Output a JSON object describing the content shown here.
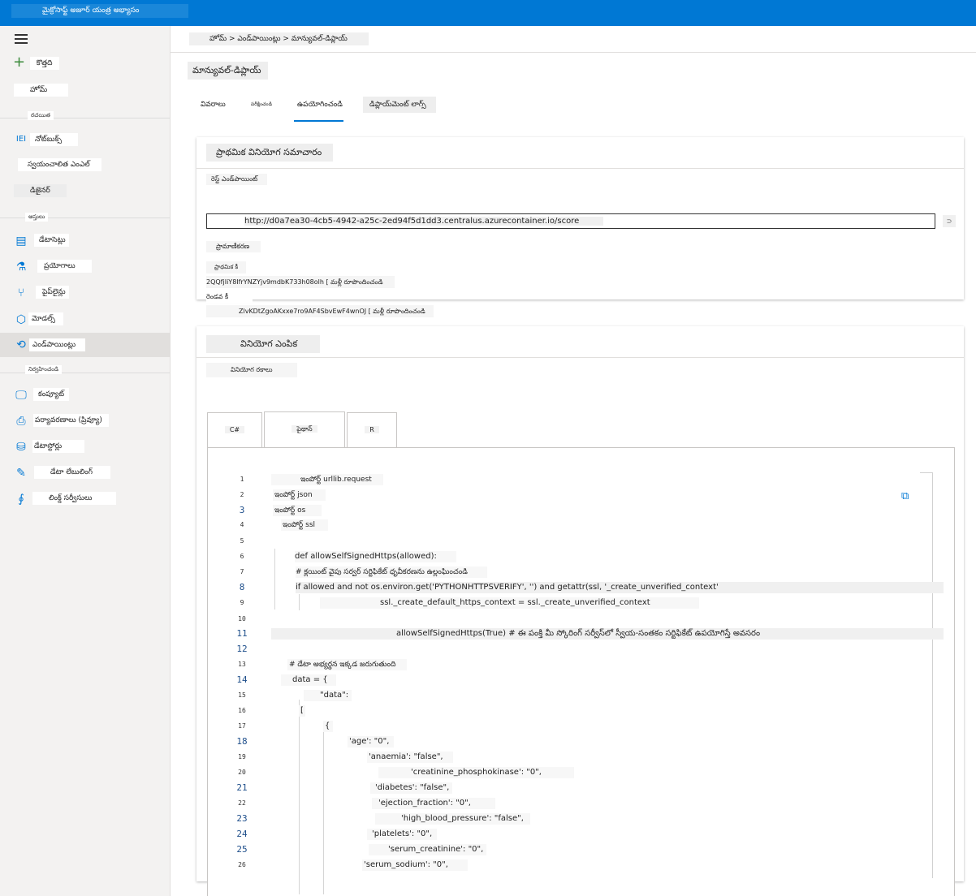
{
  "app": {
    "title": "మైక్రోసాఫ్ట్ అజూర్ యంత్ర అభ్యాసం"
  },
  "sidebar": {
    "new_label": "కొత్తది",
    "home_label": "హోమ్",
    "section_author": "రచయిత",
    "items_author": [
      {
        "label": "నోట్‌బుక్స్",
        "icon": "notebook-icon"
      },
      {
        "label": "స్వయంచాలిత ఎంఎల్",
        "icon": "automl-icon"
      },
      {
        "label": "డిజైనర్",
        "icon": "designer-icon"
      }
    ],
    "section_assets": "ఆస్తులు",
    "items_assets": [
      {
        "label": "డేటాసెట్లు",
        "icon": "dataset-icon"
      },
      {
        "label": "ప్రయోగాలు",
        "icon": "flask-icon"
      },
      {
        "label": "పైప్‌లైన్లు",
        "icon": "pipeline-icon"
      },
      {
        "label": "మోడల్స్",
        "icon": "cube-icon"
      },
      {
        "label": "ఎండ్‌పాయింట్లు",
        "icon": "endpoint-icon"
      }
    ],
    "section_manage": "నిర్వహించండి",
    "items_manage": [
      {
        "label": "కంప్యూట్",
        "icon": "monitor-icon"
      },
      {
        "label": "పర్యావరణాలు (ప్రివ్యూ)",
        "icon": "environment-icon"
      },
      {
        "label": "డేటాస్టోర్లు",
        "icon": "database-icon"
      },
      {
        "label": "డేటా లేబులింగ్",
        "icon": "edit-icon"
      },
      {
        "label": "లింక్డ్ సర్వీసులు",
        "icon": "link-icon"
      }
    ]
  },
  "breadcrumb": "హోమ్ > ఎండ్‌పాయింట్లు > మాన్యువల్-డిప్లాయ్",
  "page_title": "మాన్యువల్-డిప్లాయ్",
  "tabs": [
    "వివరాలు",
    "పరీక్షించండి",
    "ఉపయోగించండి",
    "డిప్లాయ్‌మెంట్ లాగ్స్"
  ],
  "basic_info": {
    "header": "ప్రాథమిక వినియోగ సమాచారం",
    "rest_label": "రెస్ట్ ఎండ్‌పాయింట్",
    "rest_url": "http://d0a7ea30-4cb5-4942-a25c-2ed94f5d1dd3.centralus.azurecontainer.io/score",
    "auth_label": "ప్రామాణీకరణ",
    "primary_label": "ప్రాథమిక కీ",
    "primary_key": "2QQfjIiY8IfrYNZYjv9mdbK733h08olh [ మళ్లీ రూపొందించండి",
    "secondary_label": "రెండవ కీ",
    "secondary_key": "ZlvKDtZgoAKxxe7ro9AF4SbvEwF4wnOJ [ మళ్లీ రూపొందించండి"
  },
  "consumption": {
    "header": "వినియోగ ఎంపిక",
    "types_label": "వినియోగ రకాలు",
    "code_tabs": [
      "C#",
      "పైథాన్",
      "R"
    ],
    "lines": [
      {
        "n": "1",
        "t": "ఇంపోర్ట్ urllib.request"
      },
      {
        "n": "2",
        "t": "ఇంపోర్ట్ json"
      },
      {
        "n": "3",
        "t": "ఇంపోర్ట్ os"
      },
      {
        "n": "4",
        "t": "ఇంపోర్ట్ ssl"
      },
      {
        "n": "5",
        "t": ""
      },
      {
        "n": "6",
        "t": "def allowSelfSignedHttps(allowed):"
      },
      {
        "n": "7",
        "t": "# క్లయింట్ వైపు సర్వర్ సర్టిఫికేట్ ధృవీకరణను ఉల్లంఘించండి"
      },
      {
        "n": "8",
        "t": "if allowed and not os.environ.get('PYTHONHTTPSVERIFY', '') and getattr(ssl, '_create_unverified_context'"
      },
      {
        "n": "9",
        "t": "ssl._create_default_https_context = ssl._create_unverified_context"
      },
      {
        "n": "10",
        "t": ""
      },
      {
        "n": "11",
        "t": "allowSelfSignedHttps(True) # ఈ పంక్తి మీ స్కోరింగ్ సర్వీస్‌లో స్వీయ-సంతకం సర్టిఫికేట్ ఉపయోగిస్తే అవసరం"
      },
      {
        "n": "12",
        "t": ""
      },
      {
        "n": "13",
        "t": "# డేటా అభ్యర్థన ఇక్కడ జరుగుతుంది"
      },
      {
        "n": "14",
        "t": "data = {"
      },
      {
        "n": "15",
        "t": "\"data\":"
      },
      {
        "n": "16",
        "t": "["
      },
      {
        "n": "17",
        "t": "{"
      },
      {
        "n": "18",
        "t": "'age': \"0\","
      },
      {
        "n": "19",
        "t": "'anaemia': \"false\","
      },
      {
        "n": "20",
        "t": "'creatinine_phosphokinase': \"0\","
      },
      {
        "n": "21",
        "t": "'diabetes': \"false\","
      },
      {
        "n": "22",
        "t": "'ejection_fraction': \"0\","
      },
      {
        "n": "23",
        "t": "'high_blood_pressure': \"false\","
      },
      {
        "n": "24",
        "t": "'platelets': \"0\","
      },
      {
        "n": "25",
        "t": "'serum_creatinine': \"0\","
      },
      {
        "n": "26",
        "t": "'serum_sodium': \"0\","
      }
    ]
  }
}
